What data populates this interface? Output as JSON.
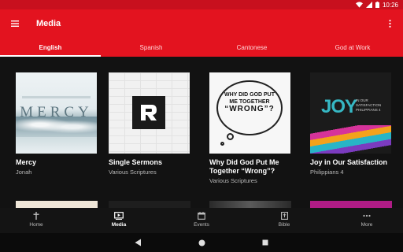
{
  "status_bar": {
    "time": "10:26",
    "icons": [
      "wifi-icon",
      "signal-icon",
      "battery-icon"
    ]
  },
  "app_bar": {
    "title": "Media",
    "menu_icon": "hamburger-menu-icon",
    "overflow_icon": "more-vert-icon"
  },
  "tabs": [
    {
      "label": "English",
      "active": true
    },
    {
      "label": "Spanish",
      "active": false
    },
    {
      "label": "Cantonese",
      "active": false
    },
    {
      "label": "God at Work",
      "active": false
    }
  ],
  "series": [
    {
      "title": "Mercy",
      "subtitle": "Jonah",
      "art_text": "MERCY"
    },
    {
      "title": "Single Sermons",
      "subtitle": "Various Scriptures"
    },
    {
      "title": "Why Did God Put Me Together “Wrong”?",
      "subtitle": "Various Scriptures",
      "art_text": [
        "WHY DID GOD PUT",
        "ME TOGETHER",
        "“WRONG”?"
      ]
    },
    {
      "title": "Joy in Our Satisfaction",
      "subtitle": "Philippians 4",
      "art_text": [
        "JOY",
        "IN OUR",
        "SATISFACTION",
        "PHILIPPIANS 4"
      ]
    }
  ],
  "bottom_nav": [
    {
      "label": "Home",
      "icon": "cross-icon",
      "active": false
    },
    {
      "label": "Media",
      "icon": "media-play-icon",
      "active": true
    },
    {
      "label": "Events",
      "icon": "calendar-icon",
      "active": false
    },
    {
      "label": "Bible",
      "icon": "bible-icon",
      "active": false
    },
    {
      "label": "More",
      "icon": "more-horiz-icon",
      "active": false
    }
  ],
  "system_nav": [
    "back-icon",
    "home-icon",
    "recents-icon"
  ],
  "colors": {
    "primary": "#e3131f",
    "status_bar": "#c8101e",
    "background": "#121212"
  }
}
